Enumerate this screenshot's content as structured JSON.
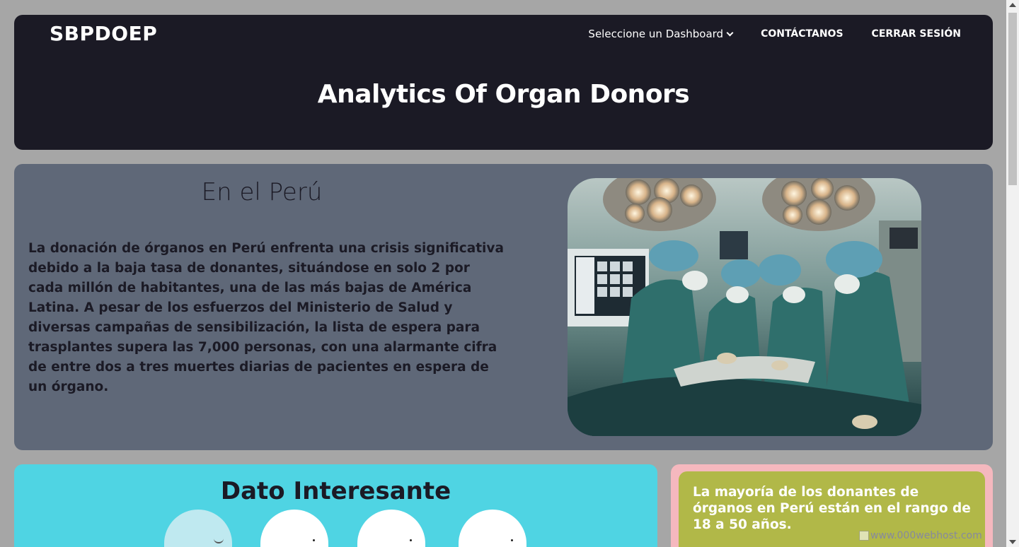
{
  "header": {
    "logo": "SBPDOEP",
    "title": "Analytics Of Organ Donors",
    "nav": {
      "dashboard_label": "Seleccione un Dashboard",
      "contact_label": "CONTÁCTANOS",
      "logout_label": "CERRAR SESIÓN"
    }
  },
  "peru": {
    "heading": "En el Perú",
    "text": "La donación de órganos en Perú enfrenta una crisis significativa debido a la baja tasa de donantes, situándose en solo 2 por cada millón de habitantes, una de las más bajas de América Latina. A pesar de los esfuerzos del Ministerio de Salud y diversas campañas de sensibilización, la lista de espera para trasplantes supera las 7,000 personas, con una alarmante cifra de entre dos a tres muertes diarias de pacientes en espera de un órgano."
  },
  "dato": {
    "title": "Dato Interesante"
  },
  "fact": {
    "text": "La mayoría de los donantes de órganos en Perú están en el rango de 18 a 50 años."
  },
  "watermark": {
    "text": "www.000webhost.com"
  },
  "colors": {
    "header_bg": "#1b1a25",
    "peru_bg": "#5f6878",
    "dato_bg": "#4fd4e3",
    "pink_bg": "#f5b8be",
    "olive_bg": "#b1b848",
    "page_bg": "#a6a6a6"
  }
}
